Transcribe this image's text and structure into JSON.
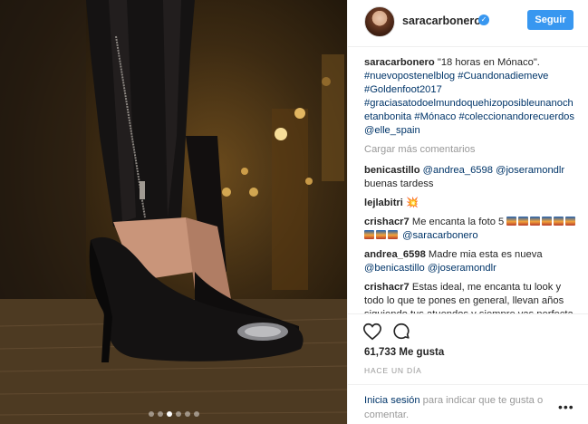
{
  "post": {
    "carousel_count": 6,
    "carousel_active": 2
  },
  "header": {
    "username": "saracarbonero",
    "verified_symbol": "✓",
    "follow_label": "Seguir"
  },
  "caption": {
    "username": "saracarbonero",
    "text": "\"18 horas en Mónaco\".",
    "hashtags": "#nuevopostenelblog #Cuandonadiemeve #Goldenfoot2017 #graciasatodoelmundoquehizoposibleunanochetanbonita #Mónaco #coleccionandorecuerdos @elle_spain"
  },
  "load_more": "Cargar más comentarios",
  "comments": [
    {
      "user": "benicastillo",
      "mentions": "@andrea_6598 @joseramondlr",
      "text": "buenas tardess"
    },
    {
      "user": "lejlabitri",
      "emoji": "💥"
    },
    {
      "user": "crishacr7",
      "text": "Me encanta la foto 5",
      "mention": "@saracarbonero",
      "emoji_count": 9
    },
    {
      "user": "andrea_6598",
      "text": "Madre mia esta es nueva",
      "mentions": "@benicastillo @joseramondlr"
    },
    {
      "user": "crishacr7",
      "text": "Estas ideal, me encanta tu look y todo lo que te pones en general, llevan años siguiendo tus atuendos y siempre vas perfecta, eres modelo a seguir",
      "emoji": "😘😘😘😘"
    }
  ],
  "actions": {
    "heart_icon": "heart-outline",
    "comment_icon": "speech-bubble",
    "likes": "61,733 Me gusta",
    "timestamp": "HACE UN DÍA"
  },
  "login": {
    "link": "Inicia sesión",
    "text": " para indicar que te gusta o comentar.",
    "more_options": "•••"
  },
  "colors": {
    "accent": "#3897f0",
    "link": "#003569",
    "muted": "#999999"
  }
}
